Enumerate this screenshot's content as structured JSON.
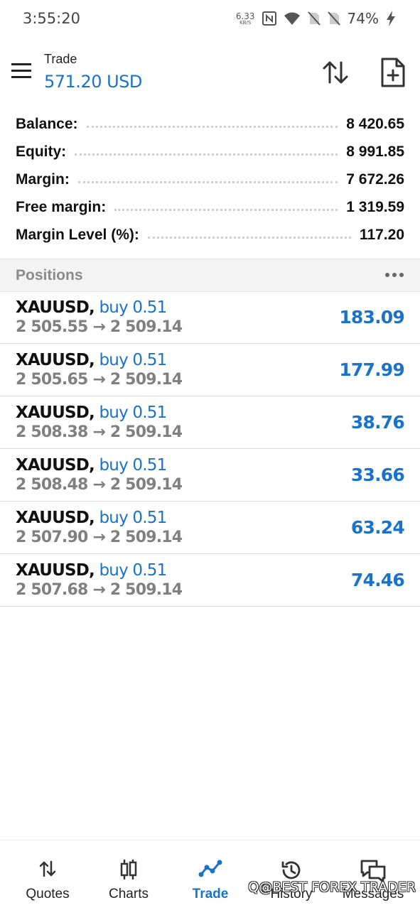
{
  "status_bar": {
    "time": "3:55:20",
    "net_speed_value": "6.33",
    "net_speed_unit": "KB/S",
    "battery": "74%"
  },
  "header": {
    "title": "Trade",
    "subtitle": "571.20 USD",
    "icons": [
      "menu-icon",
      "sort-icon",
      "new-order-icon"
    ]
  },
  "summary": [
    {
      "label": "Balance:",
      "value": "8 420.65"
    },
    {
      "label": "Equity:",
      "value": "8 991.85"
    },
    {
      "label": "Margin:",
      "value": "7 672.26"
    },
    {
      "label": "Free margin:",
      "value": "1 319.59"
    },
    {
      "label": "Margin Level (%):",
      "value": "117.20"
    }
  ],
  "positions_header": {
    "title": "Positions"
  },
  "positions": [
    {
      "symbol": "XAUUSD,",
      "side": "buy 0.51",
      "prices": "2 505.55 → 2 509.14",
      "profit": "183.09"
    },
    {
      "symbol": "XAUUSD,",
      "side": "buy 0.51",
      "prices": "2 505.65 → 2 509.14",
      "profit": "177.99"
    },
    {
      "symbol": "XAUUSD,",
      "side": "buy 0.51",
      "prices": "2 508.38 → 2 509.14",
      "profit": "38.76"
    },
    {
      "symbol": "XAUUSD,",
      "side": "buy 0.51",
      "prices": "2 508.48 → 2 509.14",
      "profit": "33.66"
    },
    {
      "symbol": "XAUUSD,",
      "side": "buy 0.51",
      "prices": "2 507.90 → 2 509.14",
      "profit": "63.24"
    },
    {
      "symbol": "XAUUSD,",
      "side": "buy 0.51",
      "prices": "2 507.68 → 2 509.14",
      "profit": "74.46"
    }
  ],
  "nav": [
    {
      "label": "Quotes",
      "icon": "quotes-icon"
    },
    {
      "label": "Charts",
      "icon": "charts-icon"
    },
    {
      "label": "Trade",
      "icon": "trade-icon",
      "active": true
    },
    {
      "label": "History",
      "icon": "history-icon"
    },
    {
      "label": "Messages",
      "icon": "messages-icon"
    }
  ],
  "watermark": "Q@BEST FOREX TRADER",
  "colors": {
    "accent": "#1a73c8",
    "muted": "#808080"
  }
}
